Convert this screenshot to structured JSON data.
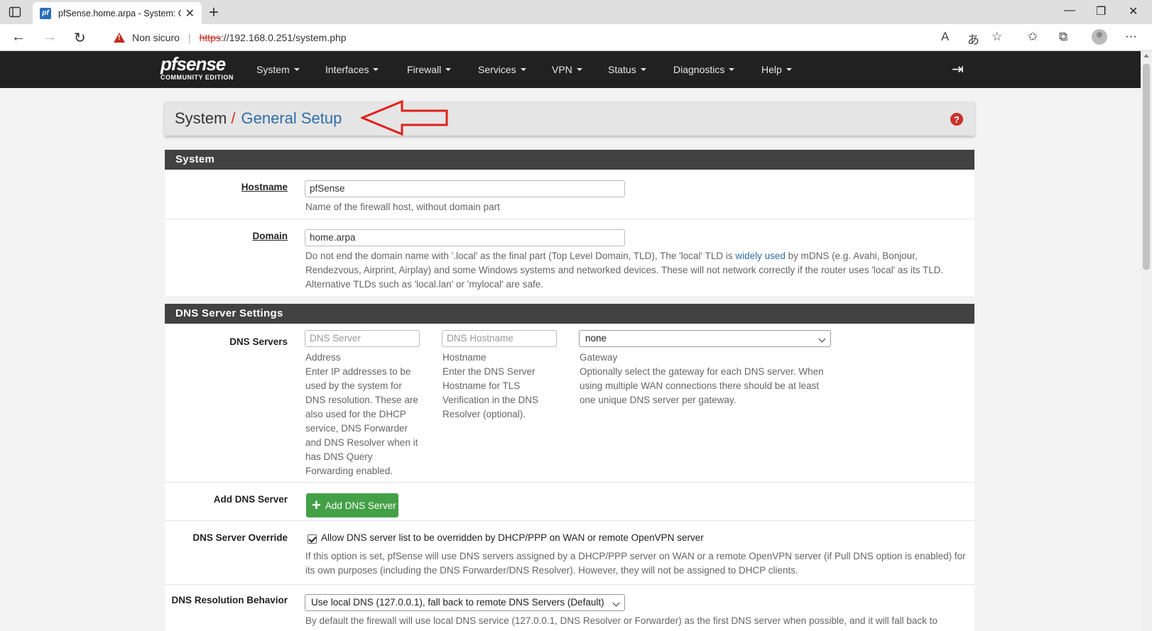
{
  "browser": {
    "tab_title": "pfSense.home.arpa - System: General Setup",
    "tab_favicon": "pf",
    "not_secure": "Non sicuro",
    "url_scheme": "https",
    "url_rest": "://192.168.0.251/system.php"
  },
  "navbar": {
    "brand": "pfsense",
    "brand_sub": "COMMUNITY EDITION",
    "menus": [
      "System",
      "Interfaces",
      "Firewall",
      "Services",
      "VPN",
      "Status",
      "Diagnostics",
      "Help"
    ]
  },
  "breadcrumb": {
    "section": "System",
    "separator": "/",
    "current": "General Setup"
  },
  "system_panel": {
    "heading": "System",
    "hostname_label": "Hostname",
    "hostname_value": "pfSense",
    "hostname_help": "Name of the firewall host, without domain part",
    "domain_label": "Domain",
    "domain_value": "home.arpa",
    "domain_help_1": "Do not end the domain name with '.local' as the final part (Top Level Domain, TLD), The 'local' TLD is ",
    "domain_help_link": "widely used",
    "domain_help_2": " by mDNS (e.g. Avahi, Bonjour, Rendezvous, Airprint, Airplay) and some Windows systems and networked devices. These will not network correctly if the router uses 'local' as its TLD. Alternative TLDs such as 'local.lan' or 'mylocal' are safe."
  },
  "dns_panel": {
    "heading": "DNS Server Settings",
    "servers_label": "DNS Servers",
    "server_placeholder": "DNS Server",
    "hostname_placeholder": "DNS Hostname",
    "gateway_selected": "none",
    "address_title": "Address",
    "address_help": "Enter IP addresses to be used by the system for DNS resolution. These are also used for the DHCP service, DNS Forwarder and DNS Resolver when it has DNS Query Forwarding enabled.",
    "hostname_title": "Hostname",
    "hostname_help": "Enter the DNS Server Hostname for TLS Verification in the DNS Resolver (optional).",
    "gateway_title": "Gateway",
    "gateway_help": "Optionally select the gateway for each DNS server. When using multiple WAN connections there should be at least one unique DNS server per gateway.",
    "add_label": "Add DNS Server",
    "add_button": "Add DNS Server",
    "override_label": "DNS Server Override",
    "override_check_label": "Allow DNS server list to be overridden by DHCP/PPP on WAN or remote OpenVPN server",
    "override_checked": true,
    "override_help": "If this option is set, pfSense will use DNS servers assigned by a DHCP/PPP server on WAN or a remote OpenVPN server (if Pull DNS option is enabled) for its own purposes (including the DNS Forwarder/DNS Resolver). However, they will not be assigned to DHCP clients.",
    "resolution_label": "DNS Resolution Behavior",
    "resolution_selected": "Use local DNS (127.0.0.1), fall back to remote DNS Servers (Default)",
    "resolution_help": "By default the firewall will use local DNS service (127.0.0.1, DNS Resolver or Forwarder) as the first DNS server when possible, and it will fall back to"
  },
  "colors": {
    "navbar_bg": "#212121",
    "panel_heading_bg": "#424242",
    "link_blue": "#2f6ea8",
    "danger_red": "#c9302c",
    "success_green": "#43a047"
  }
}
